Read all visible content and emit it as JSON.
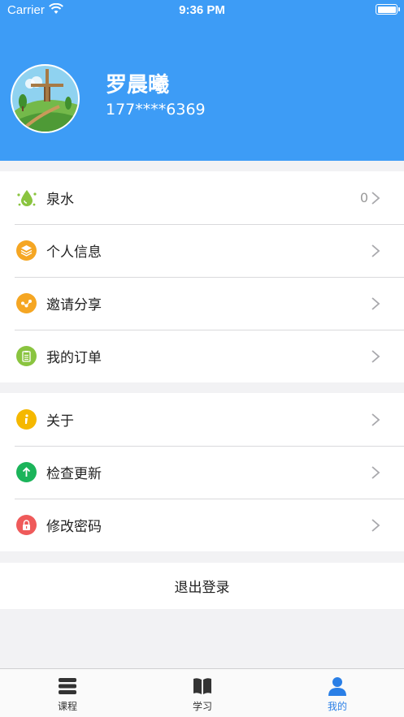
{
  "status_bar": {
    "carrier": "Carrier",
    "time": "9:36 PM"
  },
  "profile": {
    "name": "罗晨曦",
    "phone": "177****6369"
  },
  "menu_group_1": [
    {
      "label": "泉水",
      "value": "0",
      "icon": "water-drop-icon",
      "color": "#8ac43f"
    },
    {
      "label": "个人信息",
      "value": "",
      "icon": "layers-icon",
      "color": "#f5a623"
    },
    {
      "label": "邀请分享",
      "value": "",
      "icon": "share-icon",
      "color": "#f5a623"
    },
    {
      "label": "我的订单",
      "value": "",
      "icon": "clipboard-icon",
      "color": "#8ac43f"
    }
  ],
  "menu_group_2": [
    {
      "label": "关于",
      "icon": "info-icon",
      "color": "#f5b800"
    },
    {
      "label": "检查更新",
      "icon": "arrow-up-icon",
      "color": "#1bb45a"
    },
    {
      "label": "修改密码",
      "icon": "lock-icon",
      "color": "#ef5a5a"
    }
  ],
  "logout_label": "退出登录",
  "tabbar": [
    {
      "label": "课程",
      "icon": "stack-icon"
    },
    {
      "label": "学习",
      "icon": "book-icon"
    },
    {
      "label": "我的",
      "icon": "person-icon",
      "active": true
    }
  ],
  "colors": {
    "accent": "#3d9cf6",
    "tab_active": "#2a7fe6"
  }
}
